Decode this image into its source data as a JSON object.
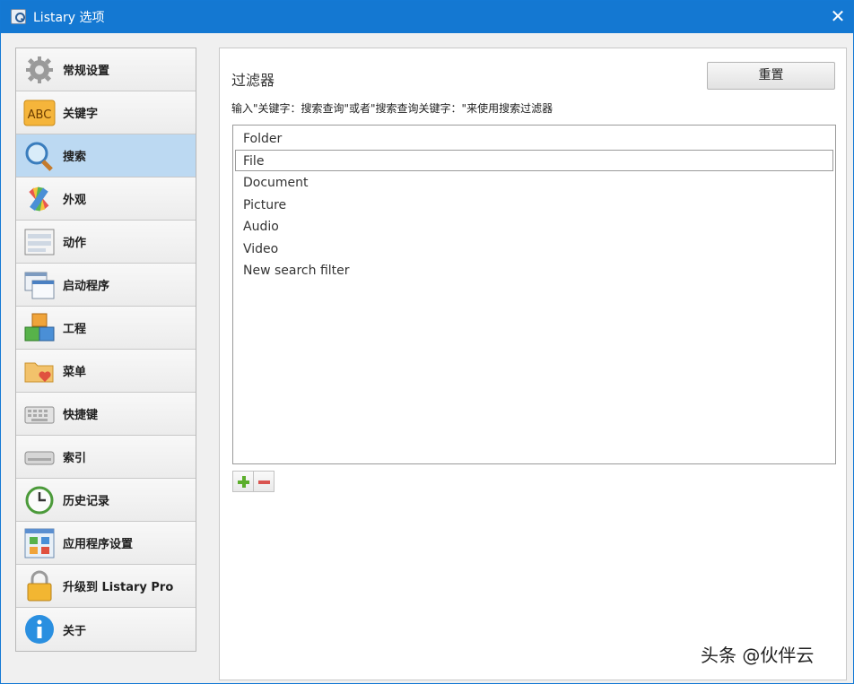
{
  "window": {
    "title": "Listary 选项",
    "close_glyph": "✕"
  },
  "sidebar": {
    "items": [
      {
        "label": "常规设置",
        "icon": "gear-icon",
        "active": false
      },
      {
        "label": "关键字",
        "icon": "abc-icon",
        "active": false,
        "icon_text": "ABC"
      },
      {
        "label": "搜索",
        "icon": "magnifier-icon",
        "active": true
      },
      {
        "label": "外观",
        "icon": "palette-icon",
        "active": false
      },
      {
        "label": "动作",
        "icon": "actions-icon",
        "active": false
      },
      {
        "label": "启动程序",
        "icon": "windows-icon",
        "active": false
      },
      {
        "label": "工程",
        "icon": "cubes-icon",
        "active": false
      },
      {
        "label": "菜单",
        "icon": "folder-heart-icon",
        "active": false
      },
      {
        "label": "快捷键",
        "icon": "keyboard-icon",
        "active": false
      },
      {
        "label": "索引",
        "icon": "drive-icon",
        "active": false
      },
      {
        "label": "历史记录",
        "icon": "history-clock-icon",
        "active": false
      },
      {
        "label": "应用程序设置",
        "icon": "app-grid-icon",
        "active": false
      },
      {
        "label": "升级到 Listary Pro",
        "icon": "lock-icon",
        "active": false
      },
      {
        "label": "关于",
        "icon": "info-icon",
        "active": false
      }
    ]
  },
  "main": {
    "title": "过滤器",
    "reset_label": "重置",
    "hint": "输入\"关键字：搜索查询\"或者\"搜索查询关键字：\"来使用搜索过滤器",
    "filters": [
      "Folder",
      "File",
      "Document",
      "Picture",
      "Audio",
      "Video",
      "New search filter"
    ],
    "selected_filter": "File"
  },
  "watermark": "头条 @伙伴云",
  "colors": {
    "titlebar": "#1478d2",
    "active_item": "#bcd9f2"
  }
}
